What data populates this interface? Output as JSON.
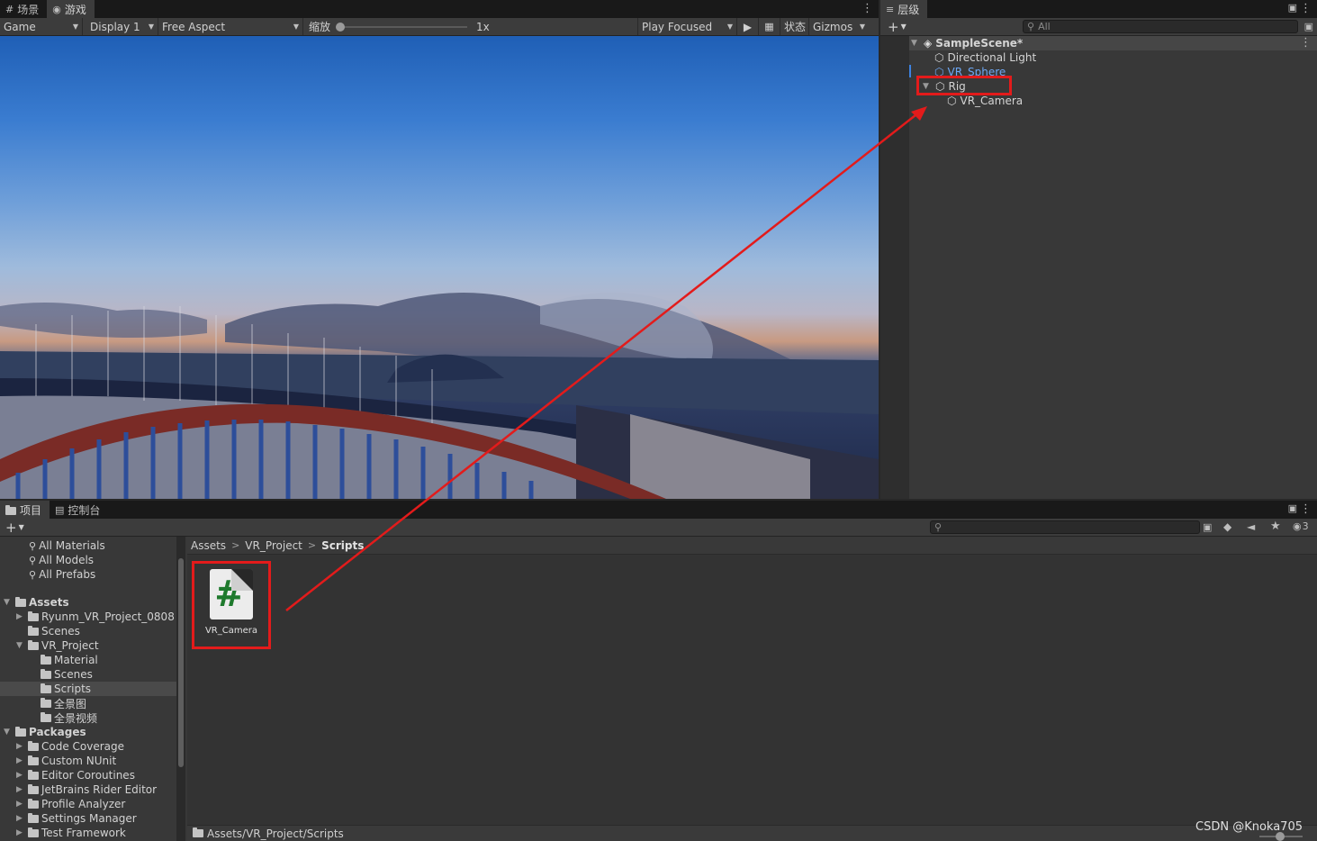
{
  "scene_tabs": {
    "scene_label": "场景",
    "game_label": "游戏",
    "scene_icon": "grid-icon",
    "game_icon": "gamepad-icon"
  },
  "game_toolbar": {
    "game_dropdown": "Game",
    "display": "Display 1",
    "aspect": "Free Aspect",
    "zoom_label": "缩放",
    "zoom_value": "1x",
    "play_mode": "Play Focused",
    "stats": "状态",
    "gizmos": "Gizmos"
  },
  "hierarchy": {
    "tab_label": "层级",
    "search_placeholder": "All",
    "scene_name": "SampleScene*",
    "items": [
      {
        "label": "Directional Light"
      },
      {
        "label": "VR_Sphere"
      },
      {
        "label": "Rig"
      },
      {
        "label": "VR_Camera"
      }
    ]
  },
  "project": {
    "tab_project": "项目",
    "tab_console": "控制台",
    "hidden_count": "3",
    "favorites": [
      "All Materials",
      "All Models",
      "All Prefabs"
    ],
    "tree": {
      "assets": "Assets",
      "ryunm": "Ryunm_VR_Project_0808",
      "scenes_root": "Scenes",
      "vr_project": "VR_Project",
      "material": "Material",
      "scenes_sub": "Scenes",
      "scripts": "Scripts",
      "panorama": "全景图",
      "panorama_video": "全景视频",
      "packages": "Packages",
      "pkg_items": [
        "Code Coverage",
        "Custom NUnit",
        "Editor Coroutines",
        "JetBrains Rider Editor",
        "Profile Analyzer",
        "Settings Manager",
        "Test Framework"
      ]
    },
    "breadcrumb": [
      "Assets",
      "VR_Project",
      "Scripts"
    ],
    "asset_name": "VR_Camera",
    "asset_glyph": "#",
    "path": "Assets/VR_Project/Scripts"
  },
  "watermark": "CSDN @Knoka705",
  "colors": {
    "highlight": "#e31b1b",
    "csharp_green": "#1f7a2d",
    "prefab_blue": "#6ea8f5"
  }
}
